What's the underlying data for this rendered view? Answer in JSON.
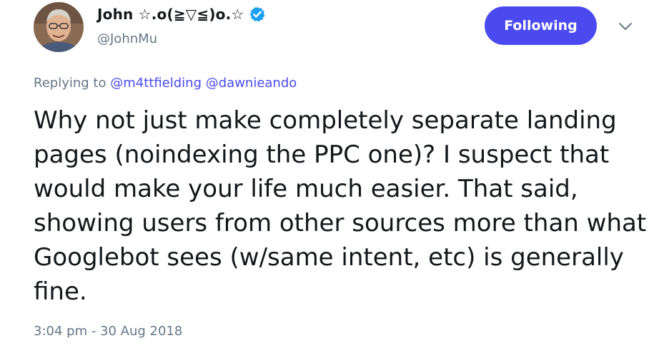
{
  "author": {
    "display_name": "John ☆.o(≧▽≦)o.☆",
    "handle": "@JohnMu",
    "verified": true
  },
  "follow_button": {
    "label": "Following",
    "color": "#4a4af0"
  },
  "menu": {
    "icon": "chevron-down-icon"
  },
  "reply_context": {
    "prefix": "Replying to",
    "mentions": [
      "@m4ttfielding",
      "@dawnieando"
    ]
  },
  "tweet": {
    "text": "Why not just make completely separate landing pages (noindexing the PPC one)? I suspect that would make your life much easier. That said, showing users from other sources more than what Googlebot sees (w/same intent, etc) is generally fine."
  },
  "timestamp": "3:04 pm - 30 Aug 2018",
  "colors": {
    "accent": "#4a4af0",
    "secondary_text": "#657786",
    "verified_badge": "#1da1f2"
  }
}
